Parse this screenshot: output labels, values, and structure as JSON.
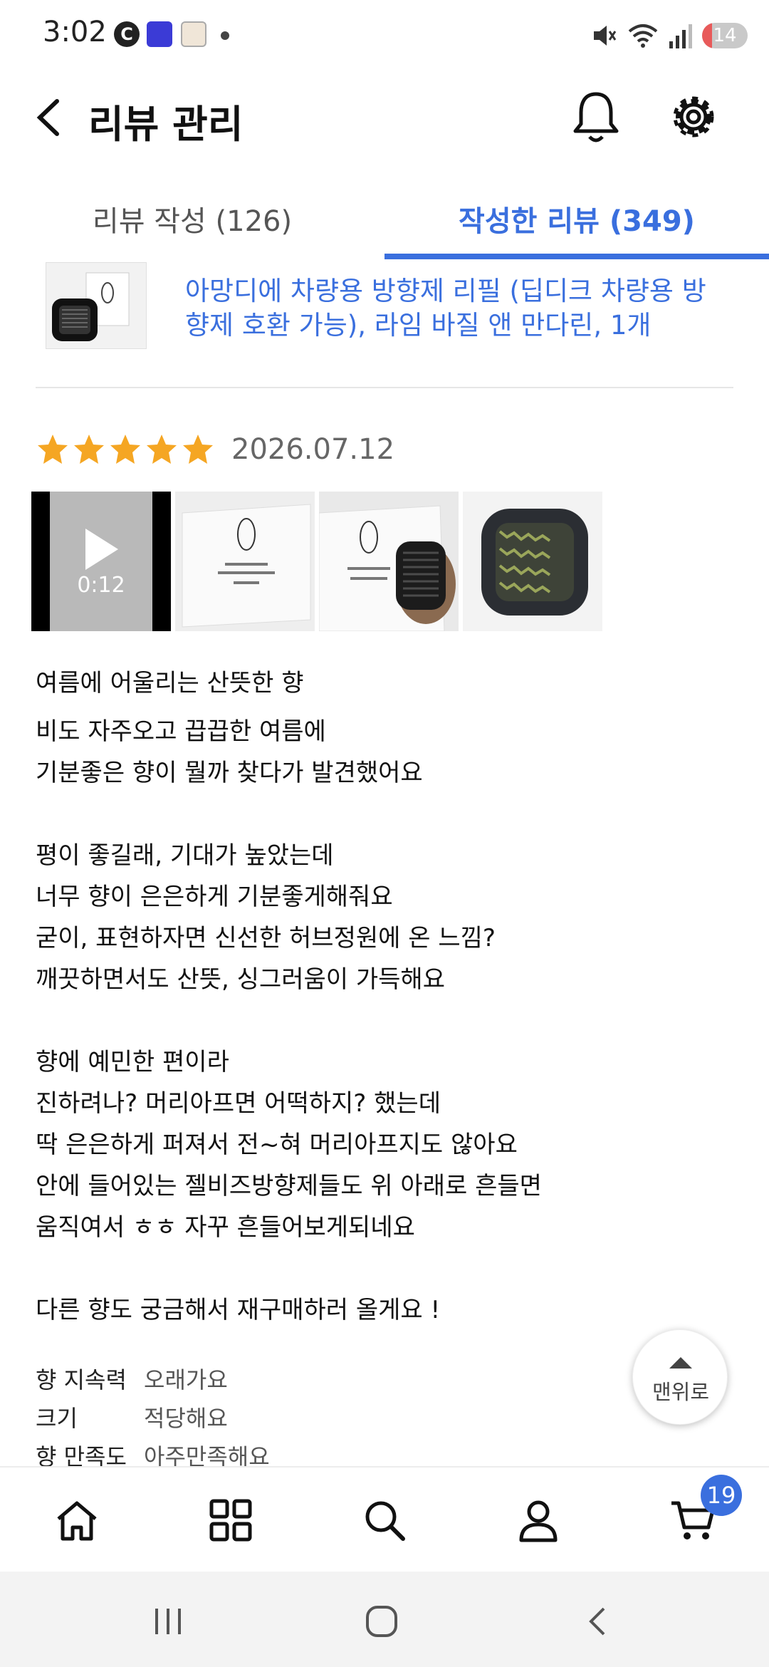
{
  "status_bar": {
    "time": "3:02",
    "battery_level": "14",
    "signal_label": "6"
  },
  "header": {
    "title": "리뷰 관리"
  },
  "tabs": [
    {
      "label": "리뷰 작성 (126)",
      "active": false
    },
    {
      "label": "작성한 리뷰 (349)",
      "active": true
    }
  ],
  "product": {
    "name": "아망디에 차량용 방향제 리필 (딥디크 차량용 방향제 호환 가능), 라임 바질 앤 만다린, 1개"
  },
  "review": {
    "rating": 5,
    "date": "2026.07.12",
    "video_duration": "0:12",
    "title": "여름에 어울리는 산뜻한 향",
    "body": "비도 자주오고 끕끕한 여름에\n기분좋은 향이 뭘까 찾다가 발견했어요\n\n평이 좋길래, 기대가 높았는데\n너무 향이 은은하게 기분좋게해줘요\n굳이, 표현하자면 신선한 허브정원에 온 느낌?\n깨끗하면서도 산뜻, 싱그러움이 가득해요\n\n향에 예민한 편이라\n진하려나? 머리아프면 어떡하지?  했는데\n딱 은은하게 퍼져서 전~혀 머리아프지도 않아요\n안에 들어있는 젤비즈방향제들도 위 아래로 흔들면\n움직여서 ㅎㅎ 자꾸 흔들어보게되네요\n\n다른 향도 궁금해서 재구매하러 올게요 !",
    "attributes": [
      {
        "key": "향 지속력",
        "value": "오래가요"
      },
      {
        "key": "크기",
        "value": "적당해요"
      },
      {
        "key": "향 만족도",
        "value": "아주만족해요"
      }
    ]
  },
  "top_button": {
    "label": "맨위로"
  },
  "bottom_nav": {
    "items": [
      "home-icon",
      "category-grid-icon",
      "search-icon",
      "profile-icon",
      "cart-icon"
    ],
    "cart_count": "19"
  },
  "colors": {
    "accent": "#3a6fde",
    "star": "#f5a623"
  }
}
